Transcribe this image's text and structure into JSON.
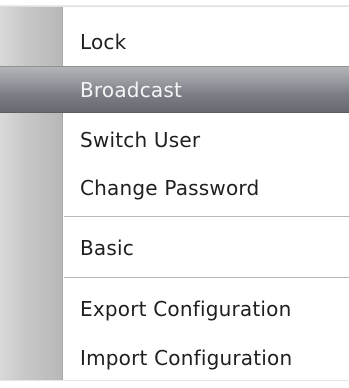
{
  "menu": {
    "items": [
      {
        "label": "Lock"
      },
      {
        "label": "Broadcast"
      },
      {
        "label": "Switch User"
      },
      {
        "label": "Change Password"
      },
      {
        "label": "Basic"
      },
      {
        "label": "Export Configuration"
      },
      {
        "label": "Import Configuration"
      }
    ],
    "highlighted_item": "Broadcast"
  },
  "colors": {
    "highlight_top": "#b4b5b9",
    "highlight_bottom": "#666970",
    "highlight_text": "#f4f4f4",
    "text": "#1f1f1f",
    "gutter": "#c8c8c8"
  }
}
